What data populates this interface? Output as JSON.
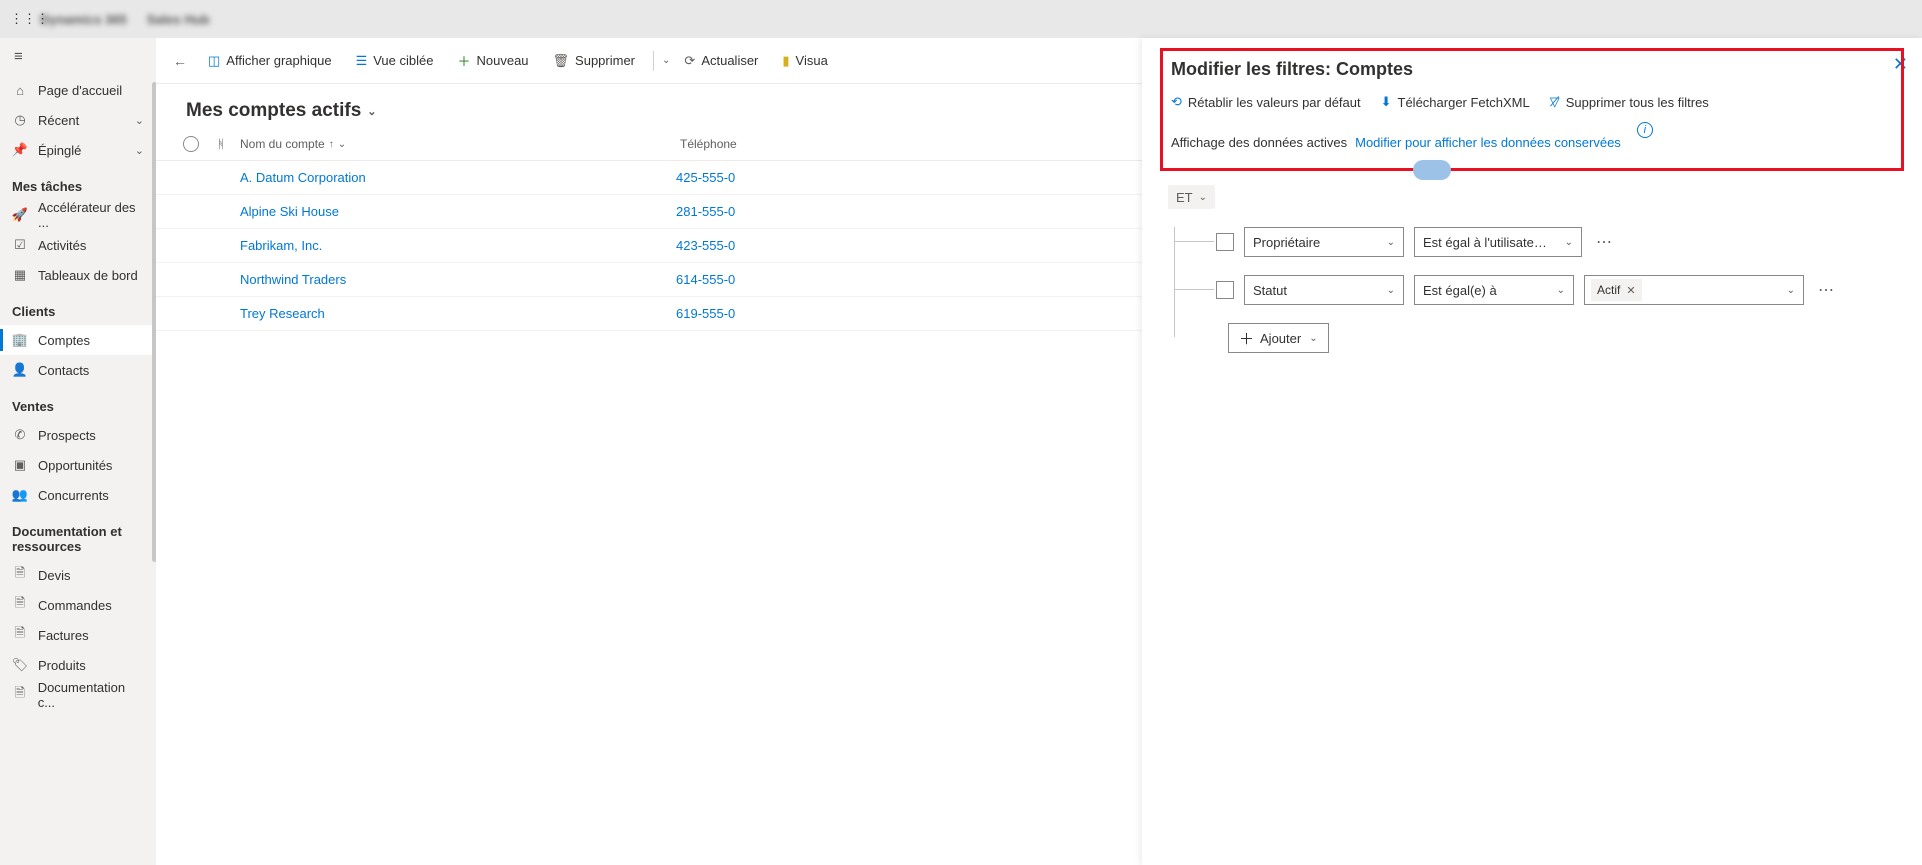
{
  "topbar": {
    "app": "Dynamics 365",
    "area": "Sales Hub"
  },
  "hamburger": "≡",
  "sidebar": {
    "home": "Page d'accueil",
    "recent": "Récent",
    "pinned": "Épinglé",
    "group_tasks": "Mes tâches",
    "accel": "Accélérateur des ...",
    "activities": "Activités",
    "dashboards": "Tableaux de bord",
    "group_clients": "Clients",
    "accounts": "Comptes",
    "contacts": "Contacts",
    "group_sales": "Ventes",
    "leads": "Prospects",
    "opps": "Opportunités",
    "competitors": "Concurrents",
    "group_collateral": "Documentation et ressources",
    "quotes": "Devis",
    "orders": "Commandes",
    "invoices": "Factures",
    "products": "Produits",
    "saleslit": "Documentation c..."
  },
  "commands": {
    "chart": "Afficher graphique",
    "focused": "Vue ciblée",
    "new": "Nouveau",
    "delete": "Supprimer",
    "refresh": "Actualiser",
    "visualize": "Visua"
  },
  "view_title": "Mes comptes actifs",
  "grid": {
    "col_name": "Nom du compte",
    "col_tel": "Téléphone",
    "rows": [
      {
        "name": "A. Datum Corporation",
        "tel": "425-555-0"
      },
      {
        "name": "Alpine Ski House",
        "tel": "281-555-0"
      },
      {
        "name": "Fabrikam, Inc.",
        "tel": "423-555-0"
      },
      {
        "name": "Northwind Traders",
        "tel": "614-555-0"
      },
      {
        "name": "Trey Research",
        "tel": "619-555-0"
      }
    ]
  },
  "drawer": {
    "title": "Modifier les filtres: Comptes",
    "reset": "Rétablir les valeurs par défaut",
    "download": "Télécharger FetchXML",
    "clear": "Supprimer tous les filtres",
    "showing": "Affichage des données actives",
    "showing_link": "Modifier pour afficher les données conservées",
    "and": "ET",
    "row1": {
      "field": "Propriétaire",
      "op": "Est égal à l'utilisateur ac..."
    },
    "row2": {
      "field": "Statut",
      "op": "Est égal(e) à",
      "val": "Actif"
    },
    "add": "Ajouter",
    "close": "✕"
  }
}
